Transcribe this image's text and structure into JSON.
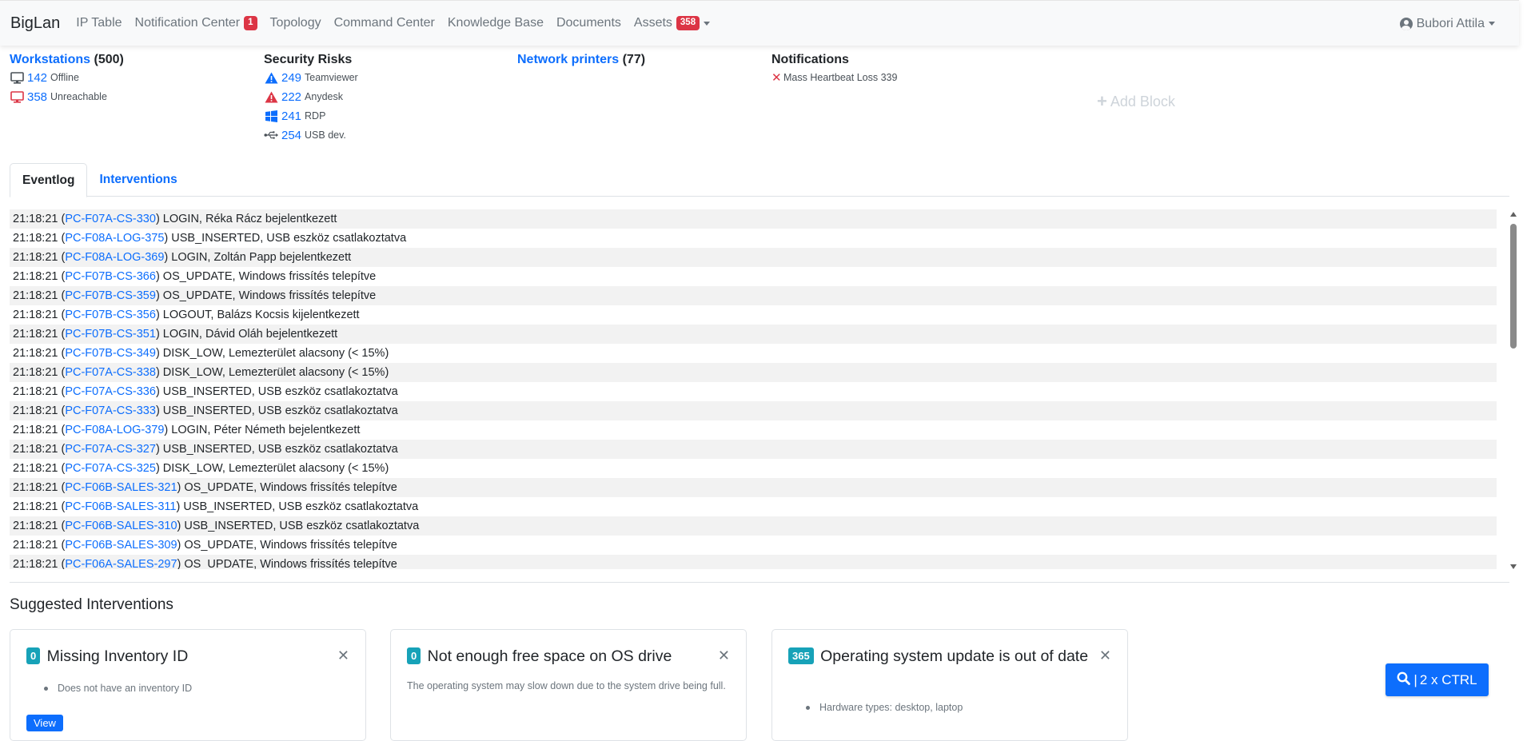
{
  "navbar": {
    "brand": "BigLan",
    "items": [
      {
        "label": "IP Table"
      },
      {
        "label": "Notification Center",
        "badge": "1"
      },
      {
        "label": "Topology"
      },
      {
        "label": "Command Center"
      },
      {
        "label": "Knowledge Base"
      },
      {
        "label": "Documents"
      },
      {
        "label": "Assets",
        "badge": "358"
      }
    ],
    "user": "Bubori Attila"
  },
  "blocks": {
    "workstations": {
      "title": "Workstations",
      "count": "(500)",
      "offline": {
        "value": "142",
        "label": "Offline"
      },
      "unreachable": {
        "value": "358",
        "label": "Unreachable"
      }
    },
    "security": {
      "title": "Security Risks",
      "items": [
        {
          "value": "249",
          "label": "Teamviewer",
          "icon": "info-triangle-icon"
        },
        {
          "value": "222",
          "label": "Anydesk",
          "icon": "warning-triangle-icon"
        },
        {
          "value": "241",
          "label": "RDP",
          "icon": "windows-icon"
        },
        {
          "value": "254",
          "label": "USB dev.",
          "icon": "usb-icon"
        }
      ]
    },
    "printers": {
      "title": "Network printers",
      "count": "(77)"
    },
    "notifications": {
      "title": "Notifications",
      "item": "Mass Heartbeat Loss 339"
    },
    "add_block": "Add Block"
  },
  "tabs": [
    {
      "label": "Eventlog",
      "active": true
    },
    {
      "label": "Interventions",
      "active": false
    }
  ],
  "eventlog": [
    {
      "time": "21:18:21",
      "host": "PC-F07A-CS-330",
      "msg": "LOGIN, Réka Rácz bejelentkezett"
    },
    {
      "time": "21:18:21",
      "host": "PC-F08A-LOG-375",
      "msg": "USB_INSERTED, USB eszköz csatlakoztatva"
    },
    {
      "time": "21:18:21",
      "host": "PC-F08A-LOG-369",
      "msg": "LOGIN, Zoltán Papp bejelentkezett"
    },
    {
      "time": "21:18:21",
      "host": "PC-F07B-CS-366",
      "msg": "OS_UPDATE, Windows frissítés telepítve"
    },
    {
      "time": "21:18:21",
      "host": "PC-F07B-CS-359",
      "msg": "OS_UPDATE, Windows frissítés telepítve"
    },
    {
      "time": "21:18:21",
      "host": "PC-F07B-CS-356",
      "msg": "LOGOUT, Balázs Kocsis kijelentkezett"
    },
    {
      "time": "21:18:21",
      "host": "PC-F07B-CS-351",
      "msg": "LOGIN, Dávid Oláh bejelentkezett"
    },
    {
      "time": "21:18:21",
      "host": "PC-F07B-CS-349",
      "msg": "DISK_LOW, Lemezterület alacsony (< 15%)"
    },
    {
      "time": "21:18:21",
      "host": "PC-F07A-CS-338",
      "msg": "DISK_LOW, Lemezterület alacsony (< 15%)"
    },
    {
      "time": "21:18:21",
      "host": "PC-F07A-CS-336",
      "msg": "USB_INSERTED, USB eszköz csatlakoztatva"
    },
    {
      "time": "21:18:21",
      "host": "PC-F07A-CS-333",
      "msg": "USB_INSERTED, USB eszköz csatlakoztatva"
    },
    {
      "time": "21:18:21",
      "host": "PC-F08A-LOG-379",
      "msg": "LOGIN, Péter Németh bejelentkezett"
    },
    {
      "time": "21:18:21",
      "host": "PC-F07A-CS-327",
      "msg": "USB_INSERTED, USB eszköz csatlakoztatva"
    },
    {
      "time": "21:18:21",
      "host": "PC-F07A-CS-325",
      "msg": "DISK_LOW, Lemezterület alacsony (< 15%)"
    },
    {
      "time": "21:18:21",
      "host": "PC-F06B-SALES-321",
      "msg": "OS_UPDATE, Windows frissítés telepítve"
    },
    {
      "time": "21:18:21",
      "host": "PC-F06B-SALES-311",
      "msg": "USB_INSERTED, USB eszköz csatlakoztatva"
    },
    {
      "time": "21:18:21",
      "host": "PC-F06B-SALES-310",
      "msg": "USB_INSERTED, USB eszköz csatlakoztatva"
    },
    {
      "time": "21:18:21",
      "host": "PC-F06B-SALES-309",
      "msg": "OS_UPDATE, Windows frissítés telepítve"
    },
    {
      "time": "21:18:21",
      "host": "PC-F06A-SALES-297",
      "msg": "OS_UPDATE, Windows frissítés telepítve"
    }
  ],
  "suggested": {
    "title": "Suggested Interventions",
    "cards": [
      {
        "badge": "0",
        "title": "Missing Inventory ID",
        "bullets": [
          "Does not have an inventory ID"
        ],
        "description": "",
        "button": "View"
      },
      {
        "badge": "0",
        "title": "Not enough free space on OS drive",
        "bullets": [],
        "description": "The operating system may slow down due to the system drive being full.",
        "button": ""
      },
      {
        "badge": "365",
        "title": "Operating system update is out of date",
        "bullets": [
          "Hardware types: desktop, laptop"
        ],
        "description": "",
        "button": ""
      }
    ]
  },
  "search_fab": {
    "label": "2 x CTRL",
    "separator": "|"
  },
  "colors": {
    "primary": "#0d6efd",
    "danger": "#dc3545",
    "info": "#17a2b8",
    "muted": "#6c757d"
  }
}
